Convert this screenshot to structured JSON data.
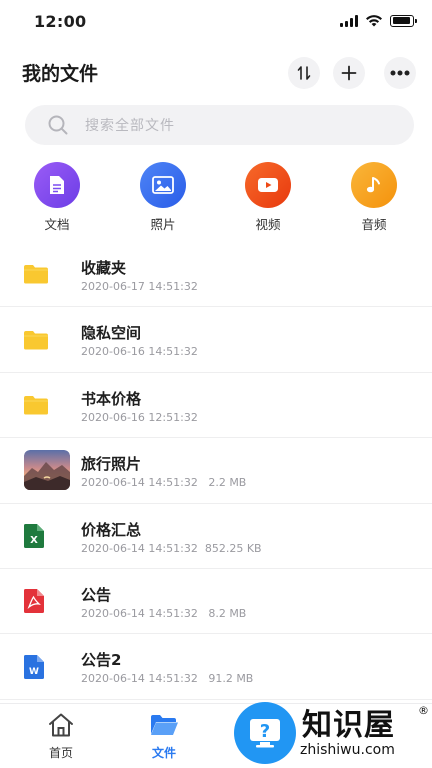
{
  "status_bar": {
    "time": "12:00"
  },
  "header": {
    "title": "我的文件",
    "icons": [
      "sort-icon",
      "add-icon",
      "more-icon"
    ]
  },
  "search": {
    "placeholder": "搜索全部文件"
  },
  "categories": [
    {
      "label": "文档",
      "icon": "document-icon",
      "color": "#7b4df0"
    },
    {
      "label": "照片",
      "icon": "photo-icon",
      "color": "#3b6ef2"
    },
    {
      "label": "视频",
      "icon": "video-icon",
      "color": "#f3511b"
    },
    {
      "label": "音频",
      "icon": "audio-icon",
      "color": "#f7a21b"
    }
  ],
  "files": [
    {
      "name": "收藏夹",
      "date": "2020-06-17 14:51:32",
      "size": "",
      "type": "folder"
    },
    {
      "name": "隐私空间",
      "date": "2020-06-16 14:51:32",
      "size": "",
      "type": "folder"
    },
    {
      "name": "书本价格",
      "date": "2020-06-16 12:51:32",
      "size": "",
      "type": "folder"
    },
    {
      "name": "旅行照片",
      "date": "2020-06-14 14:51:32",
      "size": "2.2 MB",
      "type": "image"
    },
    {
      "name": "价格汇总",
      "date": "2020-06-14 14:51:32",
      "size": "852.25 KB",
      "type": "excel"
    },
    {
      "name": "公告",
      "date": "2020-06-14 14:51:32",
      "size": "8.2 MB",
      "type": "pdf"
    },
    {
      "name": "公告2",
      "date": "2020-06-14 14:51:32",
      "size": "91.2 MB",
      "type": "word"
    }
  ],
  "bottom_nav": [
    {
      "label": "首页",
      "icon": "home-icon",
      "active": false
    },
    {
      "label": "文件",
      "icon": "folder-icon",
      "active": true
    }
  ],
  "watermark": {
    "text": "知识屋",
    "url": "zhishiwu.com",
    "reg": "®"
  },
  "colors": {
    "folder": "#f9c830",
    "excel": "#1f7a3e",
    "pdf": "#e3323a",
    "word": "#2a72e0",
    "accent": "#2a7af0"
  }
}
